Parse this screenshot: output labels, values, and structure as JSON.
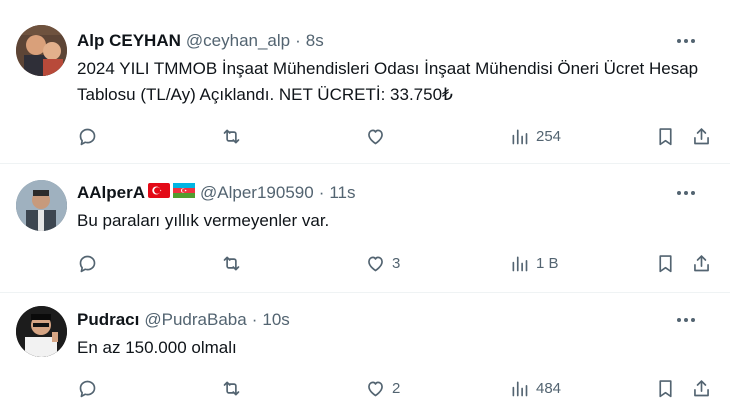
{
  "tweets": [
    {
      "display_name": "Alp CEYHAN",
      "handle": "@ceyhan_alp",
      "separator": "·",
      "time": "8s",
      "text": "2024 YILI TMMOB İnşaat Mühendisleri Odası İnşaat Mühendisi Öneri Ücret Hesap Tablosu (TL/Ay) Açıklandı. NET ÜCRETİ: 33.750₺",
      "reply_count": "",
      "retweet_count": "",
      "like_count": "",
      "view_count": "254",
      "avatar": "avatar-photo"
    },
    {
      "display_name": "AAlperA",
      "flags": [
        "turkey-flag-icon",
        "azerbaijan-flag-icon"
      ],
      "handle": "@Alper190590",
      "separator": "·",
      "time": "11s",
      "text": "Bu paraları yıllık vermeyenler var.",
      "reply_count": "",
      "retweet_count": "",
      "like_count": "3",
      "view_count": "1 B",
      "avatar": "avatar-photo"
    },
    {
      "display_name": "Pudracı",
      "handle": "@PudraBaba",
      "separator": "·",
      "time": "10s",
      "text": "En az 150.000 olmalı",
      "reply_count": "",
      "retweet_count": "",
      "like_count": "2",
      "view_count": "484",
      "avatar": "avatar-photo"
    }
  ],
  "icons": {
    "more": "more-dots-icon",
    "reply": "reply-icon",
    "retweet": "retweet-icon",
    "like": "heart-icon",
    "views": "analytics-icon",
    "bookmark": "bookmark-icon",
    "share": "share-icon"
  },
  "colors": {
    "text_primary": "#0f1419",
    "text_secondary": "#536471",
    "divider": "#eff3f4",
    "turkey_red": "#e30a17",
    "azerbaijan_blue": "#00b5e2",
    "azerbaijan_red": "#ef3340",
    "azerbaijan_green": "#509e2f"
  }
}
